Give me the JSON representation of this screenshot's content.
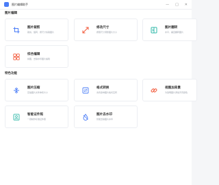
{
  "window": {
    "title": "图片编辑助手",
    "controls": [
      "—",
      "□",
      "✕"
    ]
  },
  "sections": [
    {
      "title": "图片编辑",
      "cards": [
        {
          "title": "图片裁剪",
          "desc": "裁剪、旋转、按尺寸剪裁图片",
          "icon": "crop-icon",
          "color": "#4a7cf7"
        },
        {
          "title": "修改尺寸",
          "desc": "按照尺寸调整图片大小",
          "icon": "resize-icon",
          "color": "#f25b3c"
        },
        {
          "title": "图片翻转",
          "desc": "水平、垂直翻转图片",
          "icon": "flip-icon",
          "color": "#2fb8a8"
        },
        {
          "title": "综合编辑",
          "desc": "拼图、去除水印图片编辑",
          "icon": "multi-edit-icon",
          "color": "#f25b3c"
        }
      ]
    },
    {
      "title": "特色功能",
      "cards": [
        {
          "title": "图片压缩",
          "desc": "压缩图片文件体积大小",
          "icon": "compress-icon",
          "color": "#4a7cf7"
        },
        {
          "title": "格式转换",
          "desc": "支持多种图片格式互转",
          "icon": "convert-icon",
          "color": "#4a7cf7"
        },
        {
          "title": "视图加背景",
          "desc": "为透明图片添加背景颜色",
          "icon": "link-icon",
          "color": "#f25b3c"
        },
        {
          "title": "智能证件照",
          "desc": "一键制作标准证件照",
          "icon": "id-photo-icon",
          "color": "#2fb8a8"
        },
        {
          "title": "图片去水印",
          "desc": "智能去除图片水印",
          "icon": "watermark-icon",
          "color": "#4a7cf7"
        }
      ]
    }
  ]
}
